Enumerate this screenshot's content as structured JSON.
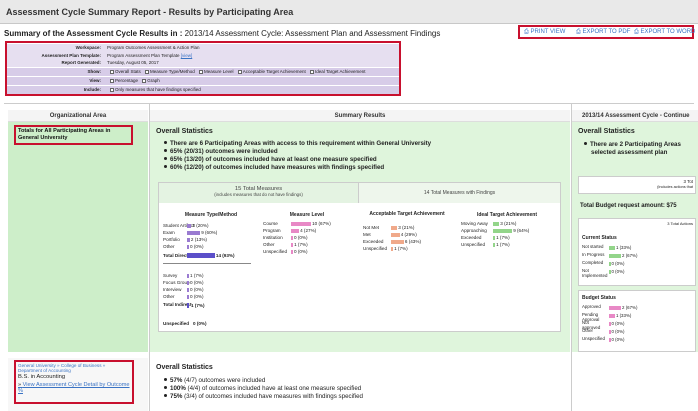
{
  "header": {
    "title": "Assessment Cycle Summary Report - Results by Participating Area"
  },
  "summary": {
    "label": "Summary of the Assessment Cycle Results in :",
    "value": "2013/14 Assessment Cycle: Assessment Plan and Assessment Findings"
  },
  "exports": {
    "print": "⎙ PRINT VIEW",
    "pdf": "⎙ EXPORT TO PDF",
    "word": "⎙ EXPORT TO WORD"
  },
  "params": {
    "workspace_k": "Workspace:",
    "workspace_v": "Program Outcomes Assessment & Action Plan",
    "template_k": "Assessment Plan Template:",
    "template_v": "Program Assessment Plan Template",
    "template_link": "[view]",
    "generated_k": "Report Generated:",
    "generated_v": "Tuesday, August 05, 2017",
    "show_k": "Show:",
    "show_opts": [
      "Overall Stats",
      "Measure Type/Method",
      "Measure Level",
      "Acceptable Target Achievement",
      "Ideal Target Achievement"
    ],
    "view_k": "View:",
    "view_opts": [
      "Percentage",
      "Graph"
    ],
    "include_k": "Include:",
    "include_v": "Only measures that have findings specified"
  },
  "columns": {
    "org": "Organizational Area",
    "summary": "Summary Results",
    "cycle": "2013/14 Assessment Cycle - Continue"
  },
  "totals": {
    "label": "Totals for All Participating Areas in General University"
  },
  "overall": {
    "title": "Overall Statistics",
    "b1": "There are 6 Participating Areas with access to this requirement within General University",
    "b2": "65% (20/31) outcomes were included",
    "b3": "65% (13/20) of outcomes included have at least one measure specified",
    "b4": "60% (12/20) of outcomes included have measures with findings specified"
  },
  "panel": {
    "tm_title": "15 Total Measures",
    "tm_sub": "(includes measures that do not have findings)",
    "tf_title": "14 Total Measures with Findings",
    "c1": "Measure Type/Method",
    "c2": "Measure Level",
    "c3": "Acceptable Target Achievement",
    "c4": "Ideal Target Achievement",
    "c1a": [
      "Student Artifact",
      "Exam",
      "Portfolio",
      "Other"
    ],
    "c1a_v": [
      "3 (20%)",
      "9 (60%)",
      "2 (13%)",
      "0 (0%)"
    ],
    "c1_total_k": "Total Direct",
    "c1_total_v": "14 (93%)",
    "c1b": [
      "Survey",
      "Focus Group",
      "Interview",
      "Other"
    ],
    "c1b_v": [
      "1 (7%)",
      "0 (0%)",
      "0 (0%)",
      "0 (0%)"
    ],
    "c1_indirect_k": "Total Indirect",
    "c1_indirect_v": "1 (7%)",
    "c1_unspec_k": "Unspecified",
    "c1_unspec_v": "0 (0%)",
    "c2l": [
      "Course",
      "Program",
      "Institution",
      "Other",
      "Unspecified"
    ],
    "c2v": [
      "10 (67%)",
      "4 (27%)",
      "0 (0%)",
      "1 (7%)",
      "0 (0%)"
    ],
    "c3l": [
      "Not Met",
      "Met",
      "Exceeded",
      "Unspecified"
    ],
    "c3v": [
      "3 (21%)",
      "4 (29%)",
      "6 (43%)",
      "1 (7%)"
    ],
    "c4l": [
      "Moving Away",
      "Approaching",
      "Exceeded",
      "Unspecified"
    ],
    "c4v": [
      "3 (21%)",
      "9 (64%)",
      "1 (7%)",
      "1 (7%)"
    ]
  },
  "right": {
    "title": "Overall Statistics",
    "b1": "There are 2 Participating Areas",
    "b1b": "selected assessment plan",
    "tlabel": "3 Tot",
    "tsub": "(Includes actions that",
    "budget": "Total Budget request amount: $75",
    "actions": "3 Total Actions",
    "cs": "Current Status",
    "csl": [
      "Not started",
      "In Progress",
      "Completed",
      "Not Implemented"
    ],
    "csv": [
      "1 (33%)",
      "2 (67%)",
      "0 (0%)",
      "0 (0%)"
    ],
    "bs": "Budget Status",
    "bsl": [
      "Approved",
      "Pending Approval",
      "Not approved",
      "Other",
      "Unspecified"
    ],
    "bsv": [
      "2 (67%)",
      "1 (33%)",
      "0 (0%)",
      "0 (0%)",
      "0 (0%)"
    ]
  },
  "bottom": {
    "breadcrumb": "General University » College of Business » Department of Accounting",
    "name": "B.S. in Accounting",
    "link": "View Assessment Cycle Detail by Outcome %",
    "title": "Overall Statistics",
    "b1p": "57%",
    "b1": " (4/7) outcomes were included",
    "b2p": "100%",
    "b2": " (4/4) of outcomes included have at least one measure specified",
    "b3p": "75%",
    "b3": " (3/4) of outcomes included have measures with findings specified"
  },
  "colors": {
    "highlight": "#c8102e",
    "link": "#3a73c4",
    "green": "#cdeec9",
    "purple": "#9a7bd1",
    "pink": "#e889c6",
    "orange": "#f0a98a",
    "lightgreen": "#93d58a"
  }
}
